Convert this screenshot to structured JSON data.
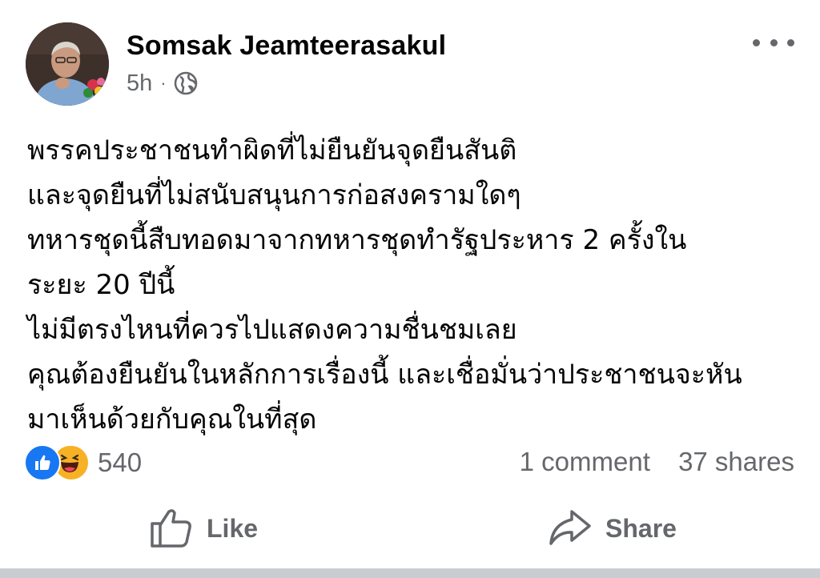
{
  "post": {
    "author": "Somsak Jeamteerasakul",
    "time": "5h",
    "separator": "·",
    "privacy_icon": "globe-icon",
    "more_icon": "more-dots-icon",
    "text_lines": [
      "พรรคประชาชนทำผิดที่ไม่ยืนยันจุดยืนสันติ",
      "และจุดยืนที่ไม่สนับสนุนการก่อสงครามใดๆ",
      "ทหารชุดนี้สืบทอดมาจากทหารชุดทำรัฐประหาร 2 ครั้งใน",
      "ระยะ 20 ปีนี้",
      "ไม่มีตรงไหนที่ควรไปแสดงความชื่นชมเลย",
      "คุณต้องยืนยันในหลักการเรื่องนี้ และเชื่อมั่นว่าประชาชนจะหัน",
      "มาเห็นด้วยกับคุณในที่สุด"
    ]
  },
  "reactions": {
    "icons": [
      "like-reaction-icon",
      "haha-reaction-icon"
    ],
    "count": "540"
  },
  "stats": {
    "comments": "1 comment",
    "shares": "37 shares"
  },
  "actions": {
    "like_label": "Like",
    "share_label": "Share"
  },
  "colors": {
    "text": "#050505",
    "secondary": "#65676b",
    "like_blue": "#1877f2",
    "haha_yellow": "#f7b125"
  }
}
